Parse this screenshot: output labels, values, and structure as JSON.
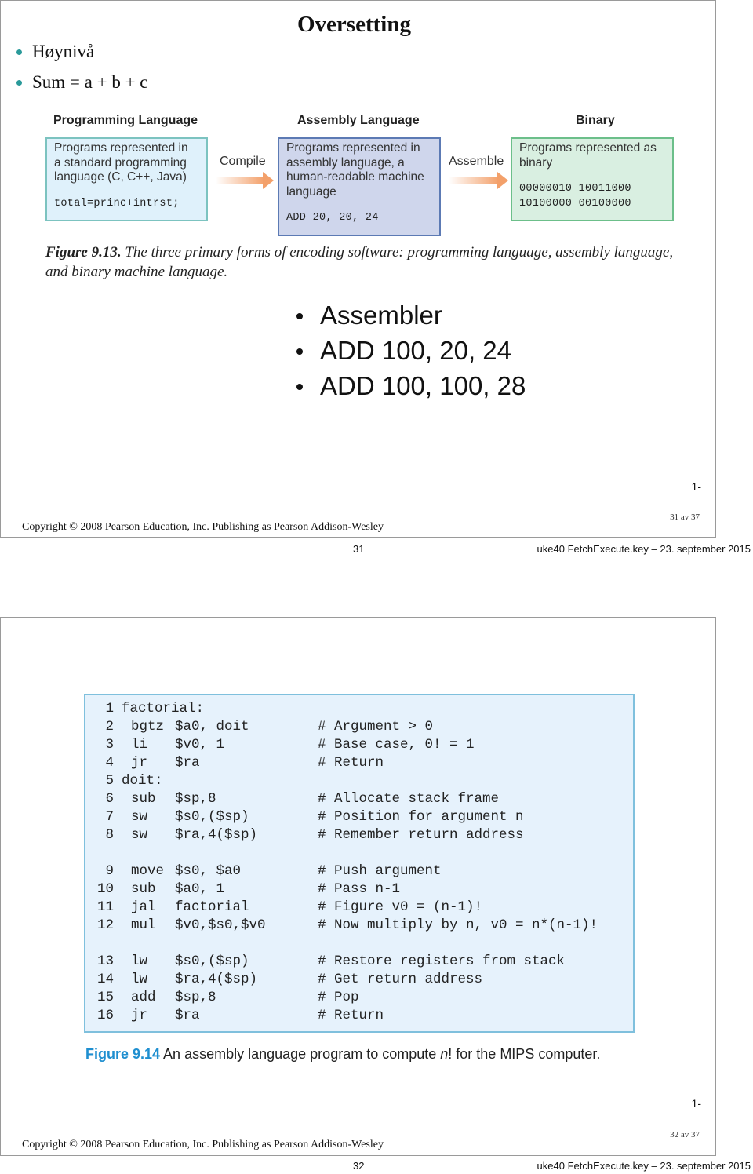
{
  "slide1": {
    "title": "Oversetting",
    "bullets": [
      "Høynivå",
      "Sum = a + b + c"
    ],
    "diagram": {
      "columns": [
        {
          "heading": "Programming Language",
          "text": [
            "Programs represented in",
            "a standard programming",
            "language (C, C++, Java)"
          ],
          "code": [
            "total=princ+intrst;"
          ]
        },
        {
          "heading": "Assembly Language",
          "text": [
            "Programs represented in",
            "assembly language, a",
            "human-readable machine",
            "language"
          ],
          "code": [
            "ADD 20, 20, 24"
          ]
        },
        {
          "heading": "Binary",
          "text": [
            "Programs represented as",
            "binary"
          ],
          "code": [
            "00000010 10011000",
            "10100000 00100000"
          ]
        }
      ],
      "arrows": [
        "Compile",
        "Assemble"
      ],
      "colors": {
        "box1": "#dff1fb",
        "box2": "#cfd6ec",
        "box3": "#d9efe1",
        "arrow": "#f3a06a"
      }
    },
    "caption": {
      "figure_label": "Figure 9.13.",
      "text": " The three primary forms of encoding software: programming language, assembly language, and binary machine language."
    },
    "bullets2": [
      "Assembler",
      "ADD 100, 20, 24",
      "ADD 100, 100, 28"
    ],
    "slide_marker": "1-",
    "page_count": "31  av 37",
    "copyright": "Copyright © 2008 Pearson Education, Inc. Publishing as Pearson Addison-Wesley"
  },
  "footer1": {
    "page_number": "31",
    "file_info": "uke40 FetchExecute.key – 23. september 2015"
  },
  "slide2": {
    "code_lines": [
      {
        "n": "1",
        "label": "factorial:"
      },
      {
        "n": "2",
        "instr": "bgtz",
        "args": "$a0, doit",
        "comment": "# Argument > 0"
      },
      {
        "n": "3",
        "instr": "li",
        "args": "$v0, 1",
        "comment": "# Base case, 0! = 1"
      },
      {
        "n": "4",
        "instr": "jr",
        "args": "$ra",
        "comment": "# Return"
      },
      {
        "n": "5",
        "label": "doit:"
      },
      {
        "n": "6",
        "instr": "sub",
        "args": "$sp,8",
        "comment": "# Allocate stack frame"
      },
      {
        "n": "7",
        "instr": "sw",
        "args": "$s0,($sp)",
        "comment": "# Position for argument n"
      },
      {
        "n": "8",
        "instr": "sw",
        "args": "$ra,4($sp)",
        "comment": "# Remember return address"
      },
      {
        "n": "9",
        "instr": "move",
        "args": "$s0, $a0",
        "comment": "# Push argument"
      },
      {
        "n": "10",
        "instr": "sub",
        "args": "$a0, 1",
        "comment": "# Pass n-1"
      },
      {
        "n": "11",
        "instr": "jal",
        "args": "factorial",
        "comment": "# Figure v0 = (n-1)!"
      },
      {
        "n": "12",
        "instr": "mul",
        "args": "$v0,$s0,$v0",
        "comment": "# Now multiply by n, v0 = n*(n-1)!"
      },
      {
        "n": "13",
        "instr": "lw",
        "args": "$s0,($sp)",
        "comment": "# Restore registers from stack"
      },
      {
        "n": "14",
        "instr": "lw",
        "args": "$ra,4($sp)",
        "comment": "# Get return address"
      },
      {
        "n": "15",
        "instr": "add",
        "args": "$sp,8",
        "comment": "# Pop"
      },
      {
        "n": "16",
        "instr": "jr",
        "args": "$ra",
        "comment": "# Return"
      }
    ],
    "caption": {
      "figure_label": "Figure 9.14",
      "text_before": "  An assembly language program to compute ",
      "italic": "n",
      "text_after": "! for the MIPS computer."
    },
    "slide_marker": "1-",
    "page_count": "32  av 37",
    "copyright": "Copyright © 2008 Pearson Education, Inc. Publishing as Pearson Addison-Wesley"
  },
  "footer2": {
    "page_number": "32",
    "file_info": "uke40 FetchExecute.key – 23. september 2015"
  }
}
